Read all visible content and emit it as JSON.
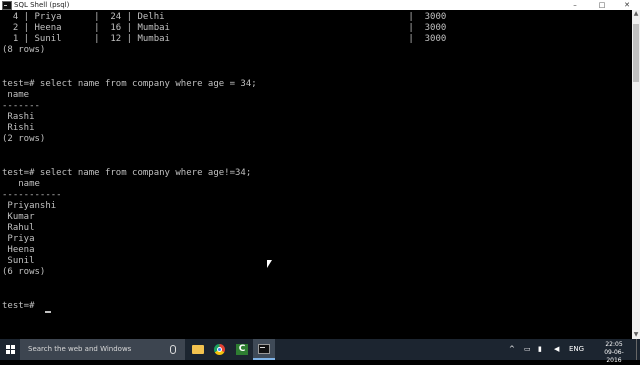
{
  "window": {
    "title": "SQL Shell (psql)",
    "controls": {
      "minimize": "–",
      "maximize": "□",
      "close": "✕"
    }
  },
  "terminal": {
    "lines": [
      "  4 | Priya      |  24 | Delhi                                             |  3000",
      "  2 | Heena      |  16 | Mumbai                                            |  3000",
      "  1 | Sunil      |  12 | Mumbai                                            |  3000",
      "(8 rows)",
      "",
      "",
      "test=# select name from company where age = 34;",
      " name",
      "-------",
      " Rashi",
      " Rishi",
      "(2 rows)",
      "",
      "",
      "test=# select name from company where age!=34;",
      "   name",
      "-----------",
      " Priyanshi",
      " Kumar",
      " Rahul",
      " Priya",
      " Heena",
      " Sunil",
      "(6 rows)",
      "",
      "",
      "test=# "
    ]
  },
  "taskbar": {
    "search_placeholder": "Search the web and Windows",
    "apps": [
      "file-explorer",
      "chrome",
      "ccleaner",
      "sql-shell"
    ],
    "language": "ENG",
    "time": "22:05",
    "date": "09-06-2016"
  }
}
